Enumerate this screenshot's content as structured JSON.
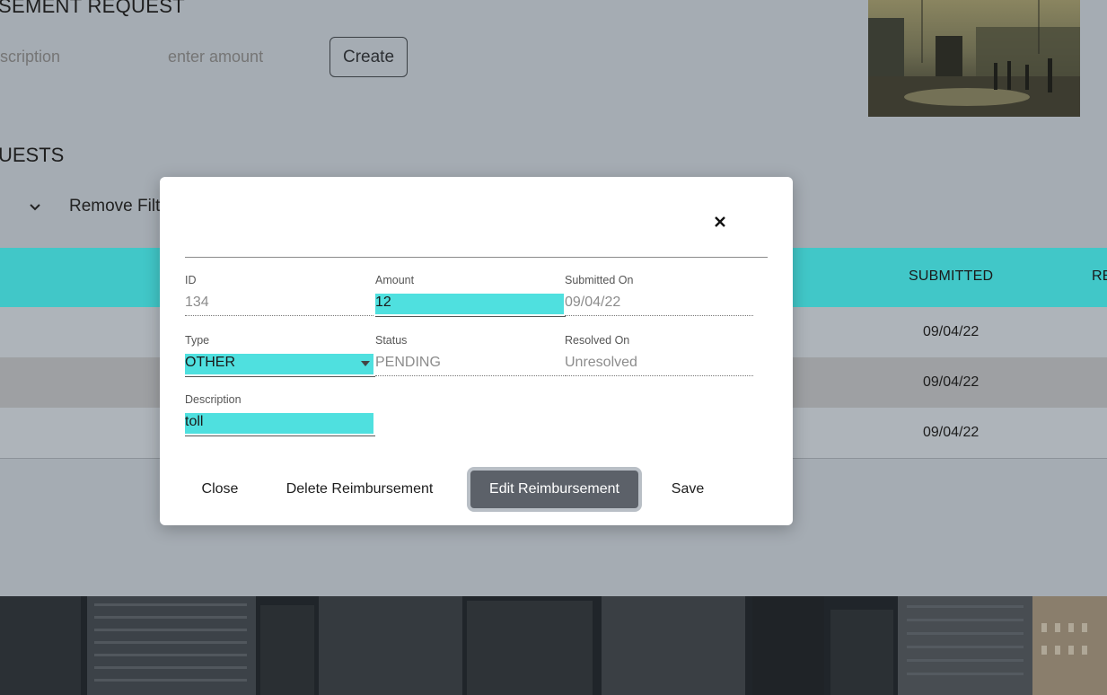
{
  "background": {
    "form_title": "SEMENT REQUEST",
    "description_placeholder": "scription",
    "amount_placeholder": "enter amount",
    "create_label": "Create",
    "list_title": "UESTS",
    "remove_filter_label": "Remove Filt",
    "table": {
      "headers": [
        "SUBMITTED",
        "RE"
      ],
      "rows": [
        {
          "submitted": "09/04/22"
        },
        {
          "submitted": "09/04/22"
        },
        {
          "submitted": "09/04/22"
        }
      ]
    }
  },
  "modal": {
    "fields": {
      "id": {
        "label": "ID",
        "value": "134"
      },
      "amount": {
        "label": "Amount",
        "value": "12"
      },
      "submitted_on": {
        "label": "Submitted On",
        "value": "09/04/22"
      },
      "type": {
        "label": "Type",
        "value": "OTHER"
      },
      "status": {
        "label": "Status",
        "value": "PENDING"
      },
      "resolved_on": {
        "label": "Resolved On",
        "value": "Unresolved"
      },
      "description": {
        "label": "Description",
        "value": "toll"
      }
    },
    "buttons": {
      "close": "Close",
      "delete": "Delete Reimbursement",
      "edit": "Edit Reimbursement",
      "save": "Save"
    }
  },
  "colors": {
    "accent": "#41c7c8",
    "active_field": "#4fe0df",
    "primary_button": "#5c6169"
  }
}
